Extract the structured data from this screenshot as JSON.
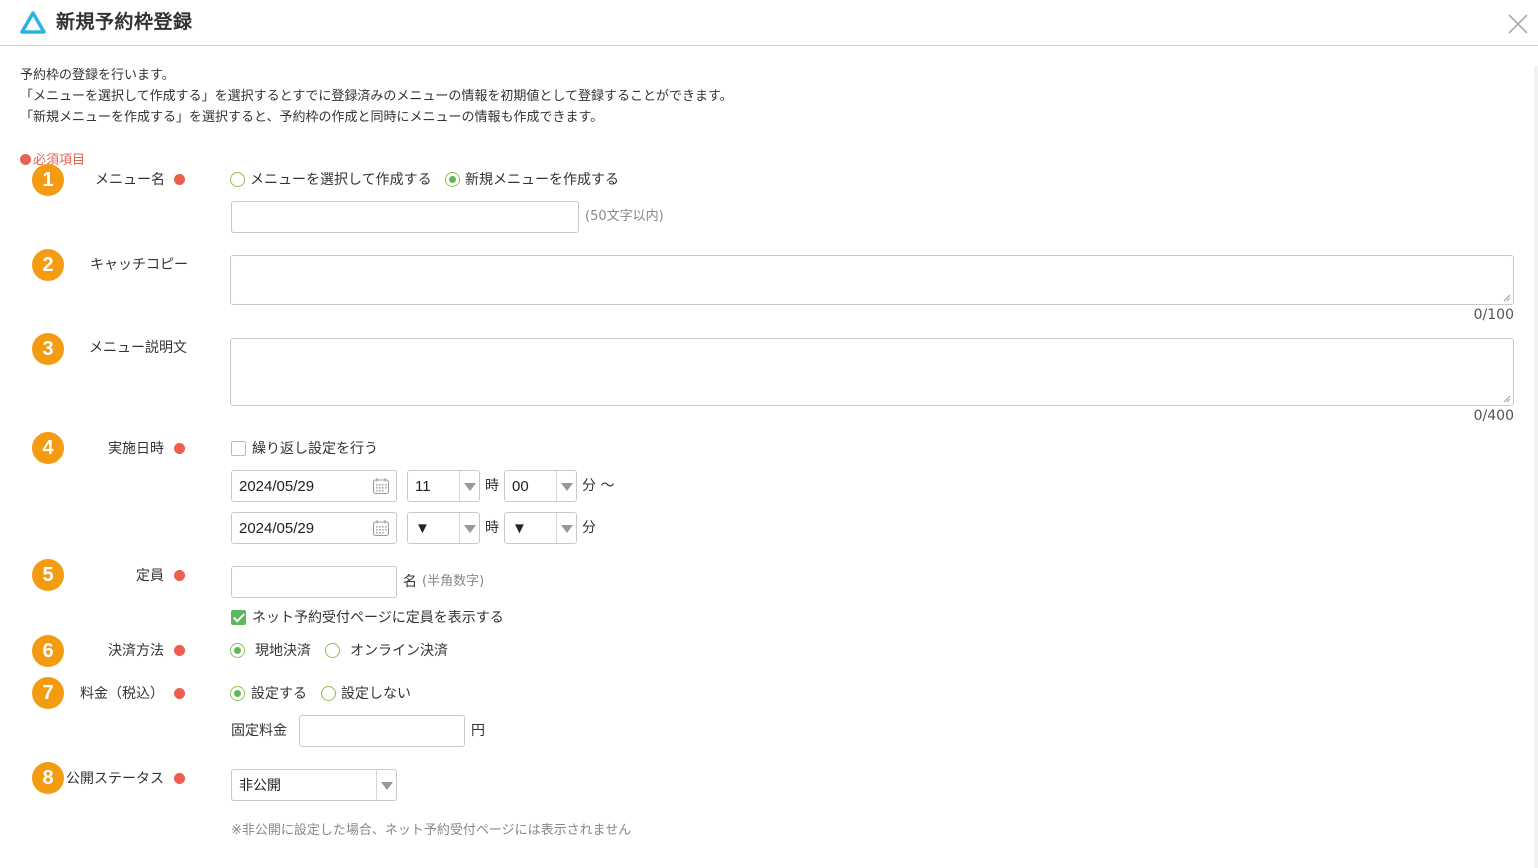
{
  "header": {
    "title": "新規予約枠登録",
    "logo_icon": "triangle-logo-icon",
    "close_icon": "close-icon"
  },
  "intro": {
    "line1": "予約枠の登録を行います。",
    "line2": "「メニューを選択して作成する」を選択するとすでに登録済みのメニューの情報を初期値として登録することができます。",
    "line3": "「新規メニューを作成する」を選択すると、予約枠の作成と同時にメニューの情報も作成できます。"
  },
  "required_note": "必須項目",
  "form": {
    "menu_name": {
      "number": "1",
      "label": "メニュー名",
      "option_select": "メニューを選択して作成する",
      "option_new": "新規メニューを作成する",
      "selected": "option_new",
      "value": "",
      "hint": "(50文字以内)"
    },
    "catch_copy": {
      "number": "2",
      "label": "キャッチコピー",
      "value": "",
      "counter": "0/100"
    },
    "description": {
      "number": "3",
      "label": "メニュー説明文",
      "value": "",
      "counter": "0/400"
    },
    "datetime": {
      "number": "4",
      "label": "実施日時",
      "repeat_label": "繰り返し設定を行う",
      "repeat_checked": false,
      "start_date": "2024/05/29",
      "start_hour": "11",
      "start_minute": "00",
      "end_date": "2024/05/29",
      "end_hour": "▼",
      "end_minute": "▼",
      "hour_unit": "時",
      "minute_unit": "分",
      "range_unit": "分 〜"
    },
    "capacity": {
      "number": "5",
      "label": "定員",
      "value": "",
      "unit": "名",
      "hint": "(半角数字)",
      "show_label": "ネット予約受付ページに定員を表示する",
      "show_checked": true
    },
    "payment": {
      "number": "6",
      "label": "決済方法",
      "option_onsite": "現地決済",
      "option_online": "オンライン決済",
      "selected": "option_onsite"
    },
    "price": {
      "number": "7",
      "label": "料金（税込）",
      "option_set": "設定する",
      "option_unset": "設定しない",
      "selected": "option_set",
      "fixed_label": "固定料金",
      "value": "",
      "unit": "円"
    },
    "status": {
      "number": "8",
      "label": "公開ステータス",
      "value": "非公開",
      "note": "※非公開に設定した場合、ネット予約受付ページには表示されません"
    }
  },
  "colors": {
    "accent_orange": "#f39c12",
    "required_red": "#ec5f4c",
    "radio_green": "#5cb85c",
    "logo_blue": "#2bb3e3"
  }
}
